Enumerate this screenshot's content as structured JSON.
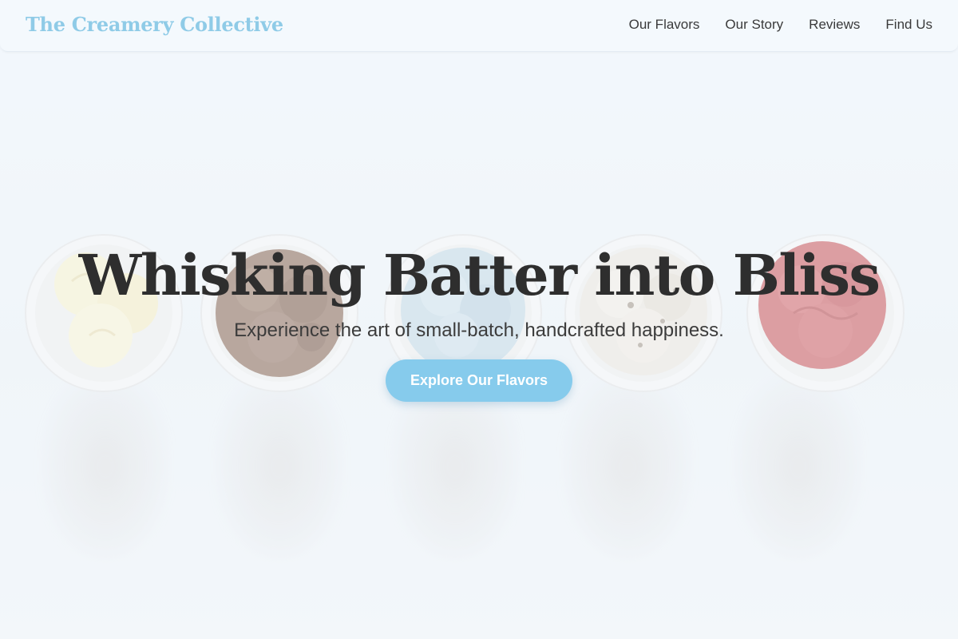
{
  "header": {
    "logo": "The Creamery Collective",
    "nav": [
      {
        "label": "Our Flavors"
      },
      {
        "label": "Our Story"
      },
      {
        "label": "Reviews"
      },
      {
        "label": "Find Us"
      }
    ]
  },
  "hero": {
    "title": "Whisking Batter into Bliss",
    "subtitle": "Experience the art of small-batch, handcrafted happiness.",
    "cta_label": "Explore Our Flavors"
  },
  "background": {
    "bowls": [
      {
        "flavor": "vanilla",
        "color": "#f7f0c8"
      },
      {
        "flavor": "chocolate",
        "color": "#8a6a58"
      },
      {
        "flavor": "blue",
        "color": "#c4d9e4"
      },
      {
        "flavor": "cookies-and-cream",
        "color": "#ece6dc"
      },
      {
        "flavor": "strawberry",
        "color": "#c85a5e"
      }
    ]
  },
  "colors": {
    "accent": "#86cbec",
    "logo": "#8fcbe7",
    "text": "#2e2e2e"
  }
}
